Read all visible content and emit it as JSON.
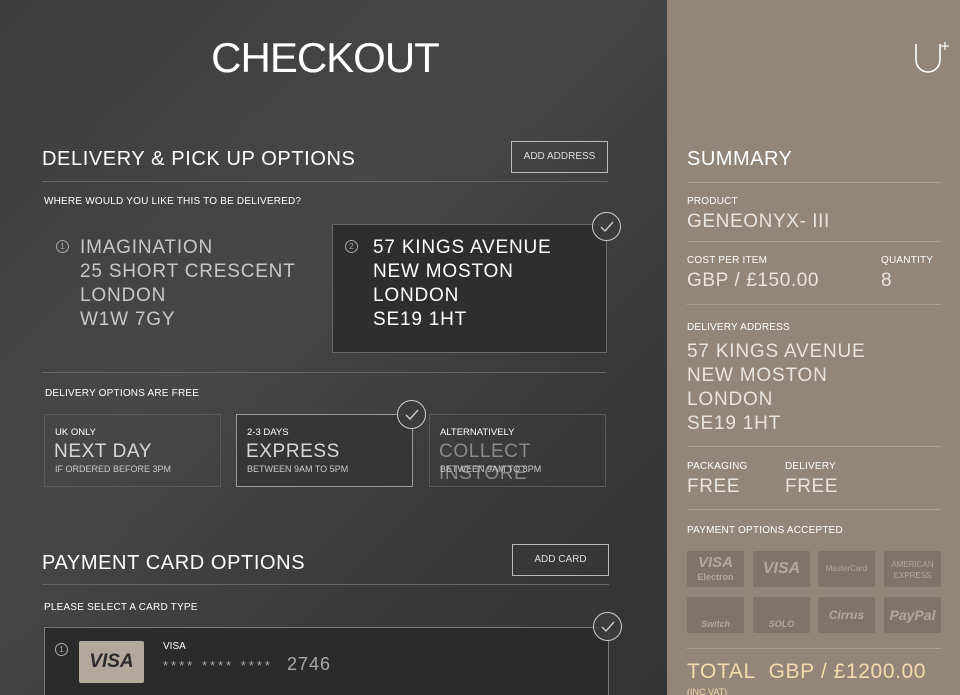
{
  "header": {
    "title": "CHECKOUT",
    "logo_icon": "u-plus-logo"
  },
  "delivery": {
    "title": "DELIVERY & PICK UP OPTIONS",
    "add_address_label": "ADD ADDRESS",
    "question": "WHERE WOULD YOU LIKE THIS TO BE DELIVERED?",
    "addresses": [
      {
        "number": "1",
        "line1": "IMAGINATION",
        "line2": "25 SHORT CRESCENT",
        "line3": "LONDON",
        "line4": "W1W 7GY",
        "selected": false
      },
      {
        "number": "2",
        "line1": "57 KINGS AVENUE",
        "line2": "NEW MOSTON",
        "line3": "LONDON",
        "line4": "SE19 1HT",
        "selected": true
      }
    ],
    "free_note": "DELIVERY OPTIONS ARE FREE",
    "options": [
      {
        "top": "UK ONLY",
        "big": "NEXT DAY",
        "bottom": "IF ORDERED BEFORE 3PM",
        "selected": false
      },
      {
        "top": "2-3 DAYS",
        "big": "EXPRESS",
        "bottom": "BETWEEN 9AM TO 5PM",
        "selected": true
      },
      {
        "top": "ALTERNATIVELY",
        "big": "COLLECT INSTORE",
        "bottom": "BETWEEN 9AM TO 8PM",
        "selected": false
      }
    ]
  },
  "payment": {
    "title": "PAYMENT CARD OPTIONS",
    "add_card_label": "ADD CARD",
    "question": "PLEASE SELECT A CARD TYPE",
    "cards": [
      {
        "number": "1",
        "logo": "VISA",
        "type": "VISA",
        "masked": "**** **** ****",
        "last4": "2746",
        "selected": true
      }
    ]
  },
  "summary": {
    "title": "SUMMARY",
    "product_label": "PRODUCT",
    "product": "GENEONYX- III",
    "cost_label": "COST PER ITEM",
    "cost": "GBP / £150.00",
    "quantity_label": "QUANTITY",
    "quantity": "8",
    "address_label": "DELIVERY ADDRESS",
    "address": [
      "57 KINGS AVENUE",
      "NEW MOSTON",
      "LONDON",
      "SE19 1HT"
    ],
    "packaging_label": "PACKAGING",
    "packaging": "FREE",
    "delivery_label": "DELIVERY",
    "delivery": "FREE",
    "payment_label": "PAYMENT OPTIONS ACCEPTED",
    "payment_methods": [
      {
        "line1": "VISA",
        "line2": "Electron"
      },
      {
        "line1": "VISA",
        "line2": ""
      },
      {
        "line1": "MasterCard",
        "line2": ""
      },
      {
        "line1": "AMERICAN",
        "line2": "EXPRESS"
      },
      {
        "line1": "Switch",
        "line2": ""
      },
      {
        "line1": "SOLO",
        "line2": ""
      },
      {
        "line1": "Cirrus",
        "line2": ""
      },
      {
        "line1": "PayPal",
        "line2": ""
      }
    ],
    "total_label": "TOTAL",
    "total": "GBP / £1200.00",
    "total_sub": "(INC VAT)"
  },
  "colors": {
    "left_bg": "#3e3e3e",
    "summary_bg": "#938577",
    "total": "#f4dcae"
  }
}
